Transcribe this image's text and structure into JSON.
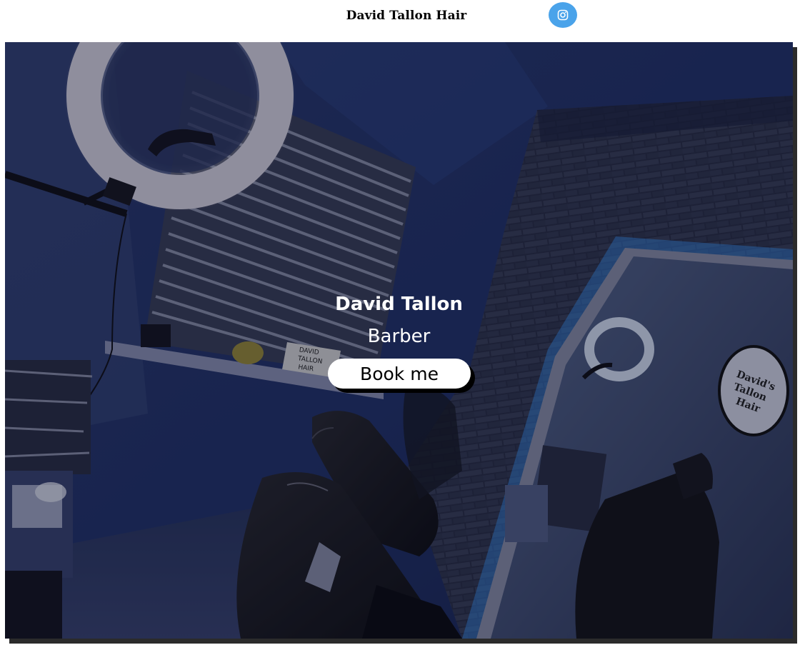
{
  "header": {
    "site_title": "David Tallon Hair",
    "instagram_icon": "instagram-icon",
    "instagram_color": "#4aa3ea"
  },
  "hero": {
    "name": "David Tallon",
    "role": "Barber",
    "book_label": "Book me",
    "lightbox_text": [
      "DAVID",
      "TALLON",
      "HAIR"
    ],
    "sign_text": [
      "David's",
      "Tallon",
      "Hair"
    ],
    "overlay_color": "#060a1e"
  }
}
